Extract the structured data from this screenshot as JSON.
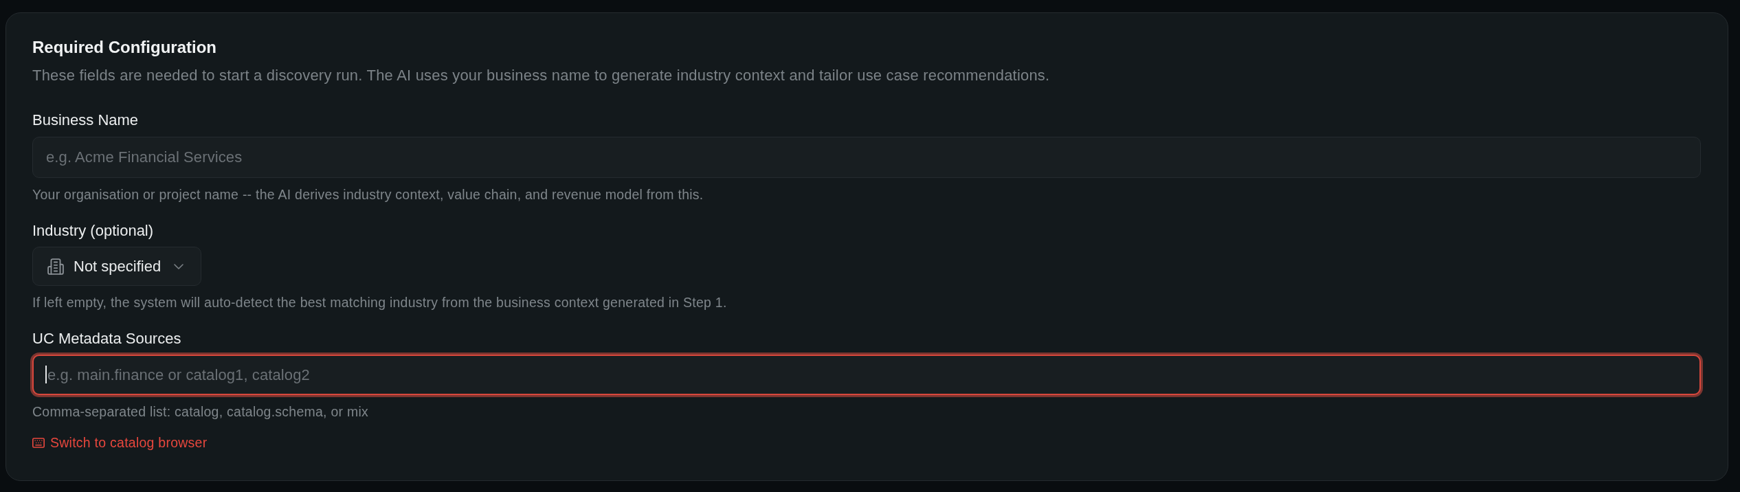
{
  "section": {
    "title": "Required Configuration",
    "description": "These fields are needed to start a discovery run. The AI uses your business name to generate industry context and tailor use case recommendations."
  },
  "fields": [
    {
      "kind": "text",
      "label": "Business Name",
      "placeholder": "e.g. Acme Financial Services",
      "help": "Your organisation or project name -- the AI derives industry context, value chain, and revenue model from this.",
      "focused": false
    },
    {
      "kind": "select",
      "label": "Industry (optional)",
      "value": "Not specified",
      "help": "If left empty, the system will auto-detect the best matching industry from the business context generated in Step 1."
    },
    {
      "kind": "text",
      "label": "UC Metadata Sources",
      "placeholder": "e.g. main.finance or catalog1, catalog2",
      "help": "Comma-separated list: catalog, catalog.schema, or mix",
      "focused": true
    }
  ],
  "link": {
    "label": "Switch to catalog browser"
  }
}
